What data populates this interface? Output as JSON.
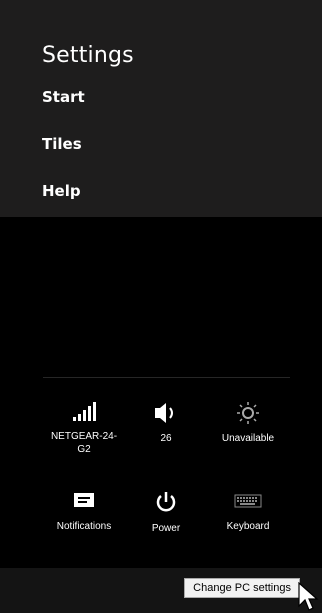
{
  "panel": {
    "title": "Settings",
    "menu": [
      {
        "label": "Start"
      },
      {
        "label": "Tiles"
      },
      {
        "label": "Help"
      }
    ]
  },
  "quick_settings": [
    {
      "icon": "network-signal-icon",
      "label": "NETGEAR-24-\nG2"
    },
    {
      "icon": "volume-icon",
      "label": "26"
    },
    {
      "icon": "brightness-icon",
      "label": "Unavailable"
    },
    {
      "icon": "notifications-icon",
      "label": "Notifications"
    },
    {
      "icon": "power-icon",
      "label": "Power"
    },
    {
      "icon": "keyboard-icon",
      "label": "Keyboard"
    }
  ],
  "footer": {
    "change_pc_settings": "Change PC settings"
  },
  "colors": {
    "panel_bg": "#1e1d1d",
    "page_bg": "#000000",
    "text": "#ffffff"
  }
}
